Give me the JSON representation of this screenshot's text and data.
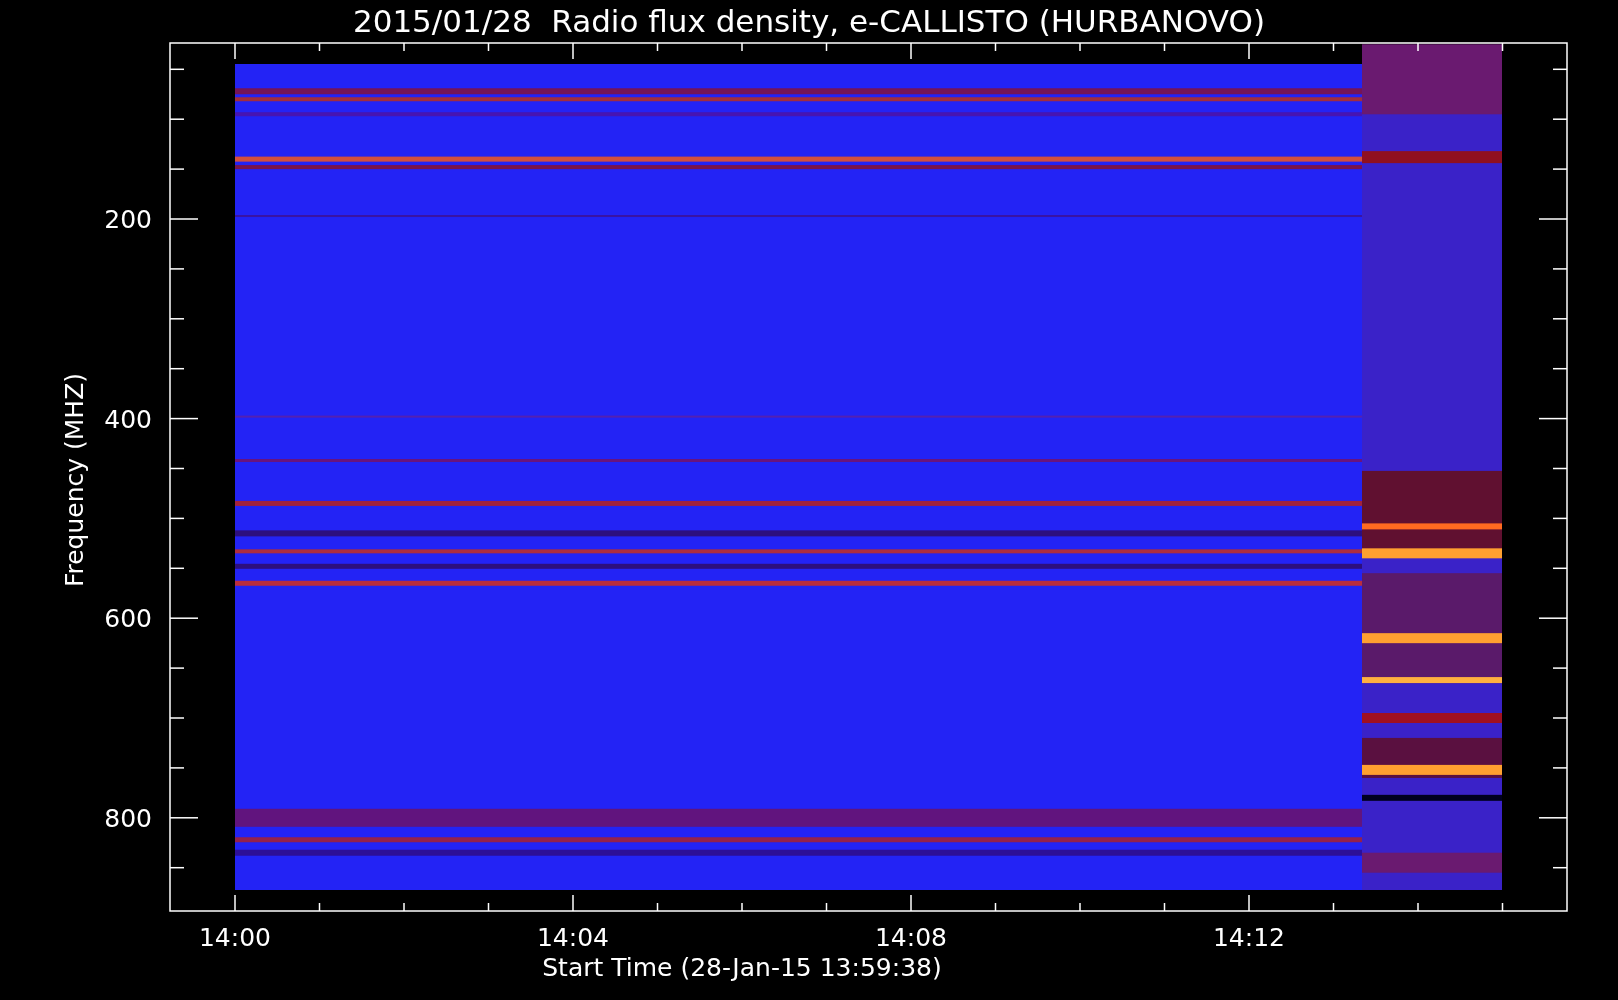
{
  "title": "2015/01/28  Radio flux density, e-CALLISTO (HURBANOVO)",
  "y_axis": {
    "label": "Frequency (MHZ)",
    "ticks": [
      "200",
      "400",
      "600",
      "800"
    ]
  },
  "x_axis": {
    "label": "Start Time (28-Jan-15 13:59:38)",
    "ticks": [
      "14:00",
      "14:04",
      "14:08",
      "14:12"
    ]
  }
}
